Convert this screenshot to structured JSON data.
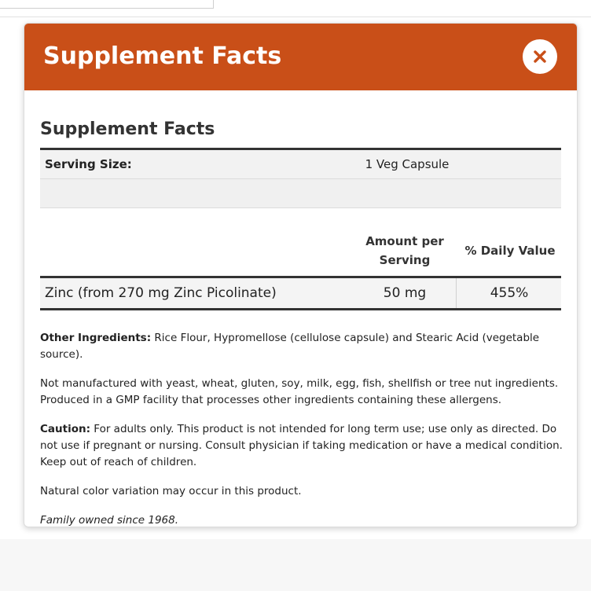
{
  "modal": {
    "header_title": "Supplement Facts",
    "close_icon": "close-icon",
    "colors": {
      "header_bg": "#c94f18",
      "header_text": "#ffffff"
    }
  },
  "facts": {
    "title": "Supplement Facts",
    "serving_size_label": "Serving Size:",
    "serving_size_value": "1 Veg Capsule",
    "columns": {
      "amount_line1": "Amount per",
      "amount_line2": "Serving",
      "daily_value": "% Daily Value"
    },
    "rows": [
      {
        "name": "Zinc (from 270 mg Zinc Picolinate)",
        "amount": "50 mg",
        "daily_value": "455%"
      }
    ]
  },
  "notes": {
    "other_ingredients_label": "Other Ingredients:",
    "other_ingredients_text": "Rice Flour, Hypromellose (cellulose capsule) and Stearic Acid (vegetable source).",
    "allergen_line1": "Not manufactured with yeast, wheat, gluten, soy, milk, egg, fish, shellfish or tree nut ingredients.",
    "allergen_line2": "Produced in a GMP facility that processes other ingredients containing these allergens.",
    "caution_label": "Caution:",
    "caution_text": "For adults only. This product is not intended for long term use; use only as directed. Do not use if pregnant or nursing. Consult physician if taking medication or have a medical condition. Keep out of reach of children.",
    "color_variation": "Natural color variation may occur in this product.",
    "family_owned": "Family owned since 1968."
  }
}
